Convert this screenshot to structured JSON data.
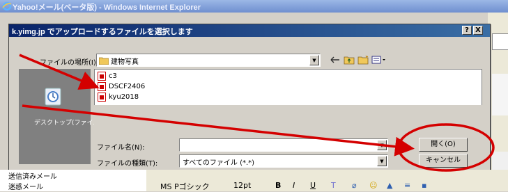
{
  "browser": {
    "title": "Yahoo!メール(ベータ版) - Windows Internet Explorer",
    "icon": "ie-logo-icon"
  },
  "dialog": {
    "title": "k.yimg.jp でアップロードするファイルを選択します",
    "help_button": "?",
    "close_button": "X",
    "location_label": "ファイルの場所(I):",
    "location_value": "建物写真",
    "filename_label": "ファイル名(N):",
    "filename_value": "",
    "filetype_label": "ファイルの種類(T):",
    "filetype_value": "すべてのファイル (*.*)",
    "open_button": "開く(O)",
    "cancel_button": "キャンセル",
    "places_item": "デスクトップ(ファイル",
    "files": [
      {
        "name": "c3"
      },
      {
        "name": "DSCF2406"
      },
      {
        "name": "kyu2018"
      }
    ]
  },
  "background_mail": {
    "sidebar_items": [
      "送信済みメール",
      "迷惑メール"
    ],
    "font_name": "MS Pゴシック",
    "font_size": "12pt"
  },
  "annotation": {
    "color": "#d40000"
  }
}
